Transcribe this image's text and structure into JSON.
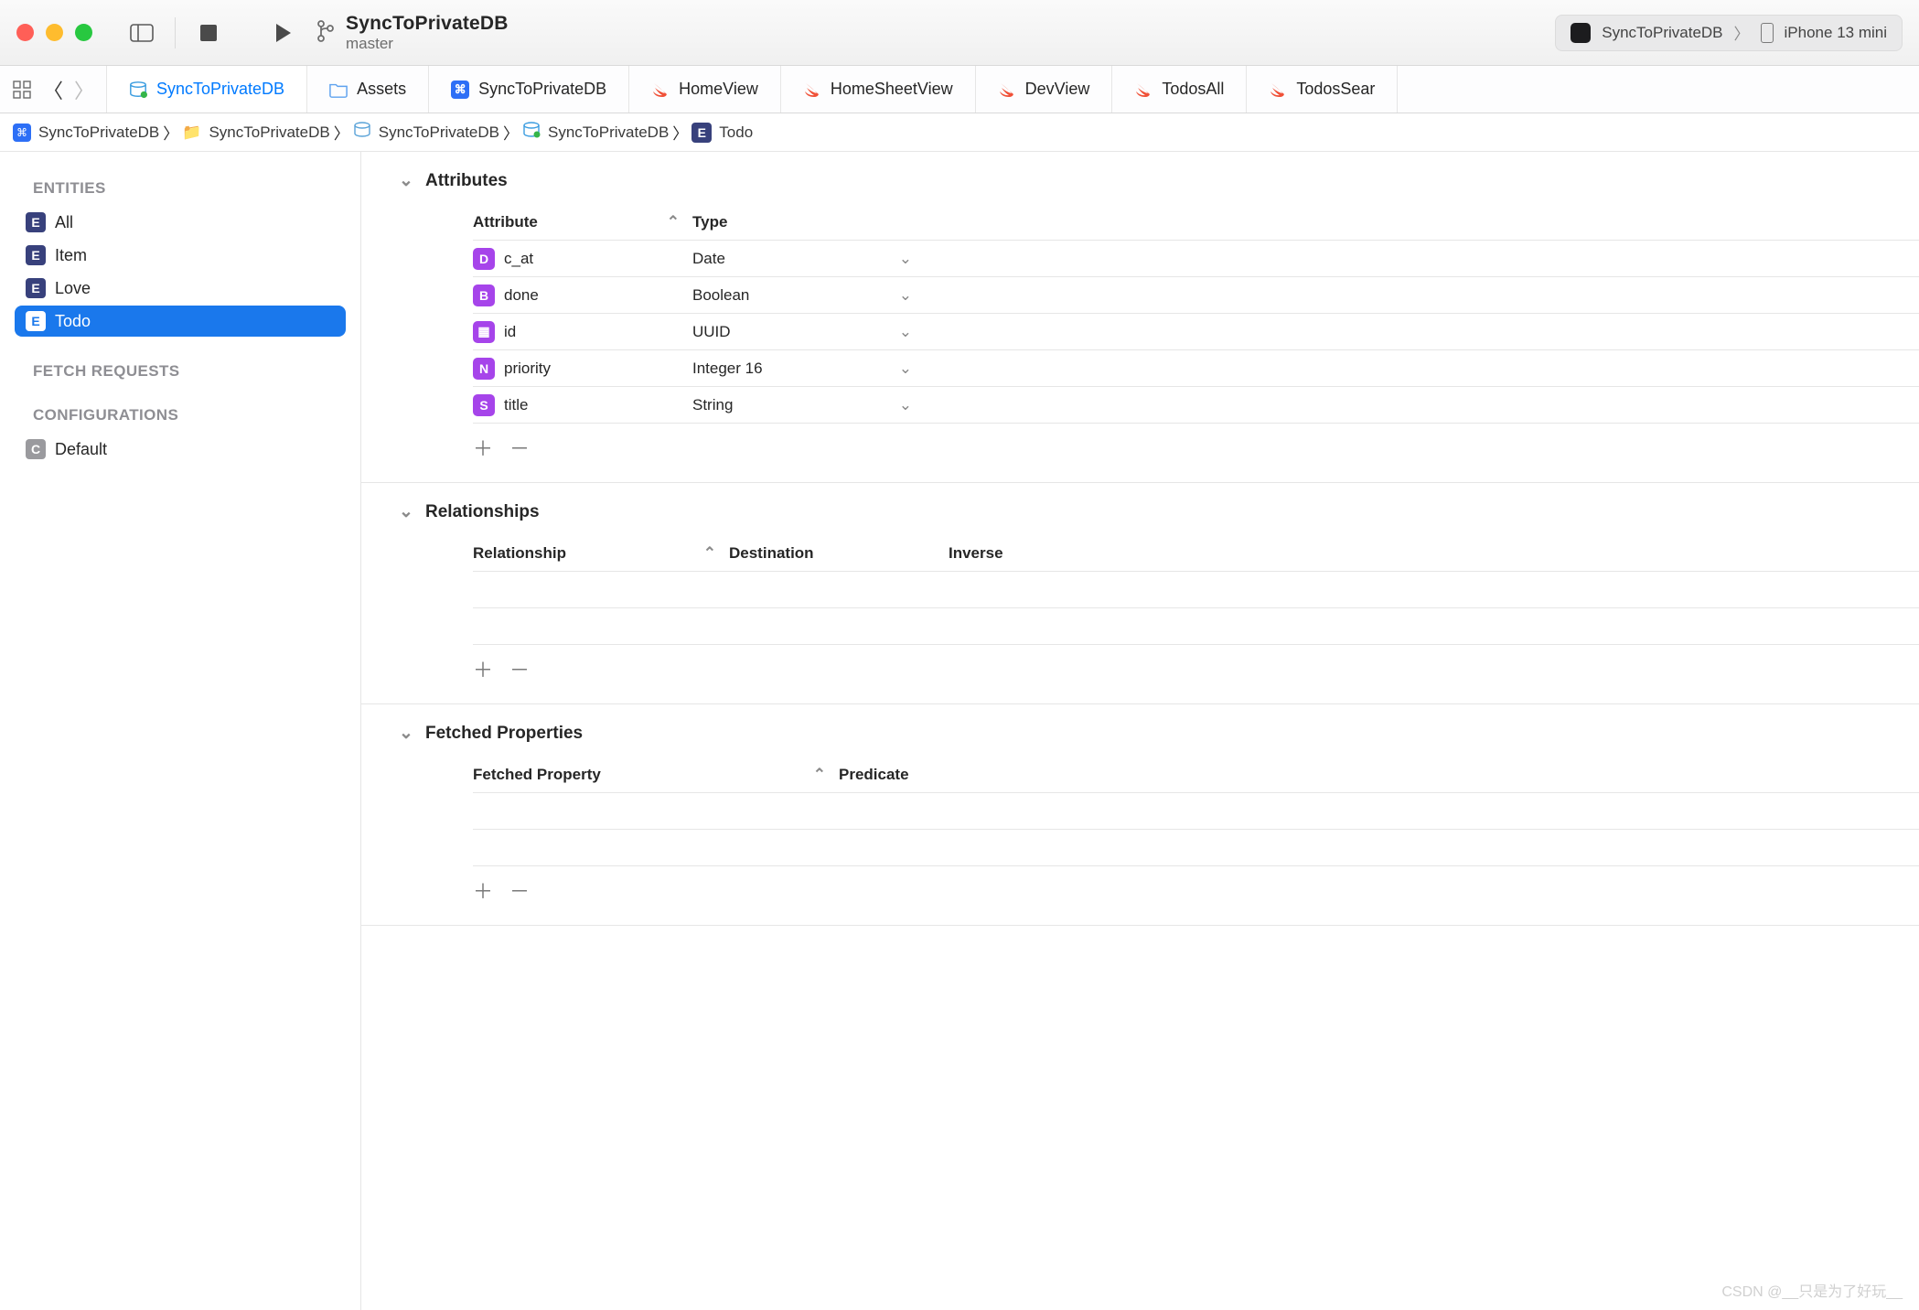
{
  "window": {
    "title": "SyncToPrivateDB",
    "branch": "master",
    "scheme": "SyncToPrivateDB",
    "device": "iPhone 13 mini"
  },
  "tabs": [
    {
      "label": "SyncToPrivateDB",
      "kind": "model",
      "active": true
    },
    {
      "label": "Assets",
      "kind": "folder"
    },
    {
      "label": "SyncToPrivateDB",
      "kind": "app"
    },
    {
      "label": "HomeView",
      "kind": "swift"
    },
    {
      "label": "HomeSheetView",
      "kind": "swift"
    },
    {
      "label": "DevView",
      "kind": "swift"
    },
    {
      "label": "TodosAll",
      "kind": "swift"
    },
    {
      "label": "TodosSear",
      "kind": "swift"
    }
  ],
  "breadcrumb": [
    {
      "label": "SyncToPrivateDB",
      "icon": "app"
    },
    {
      "label": "SyncToPrivateDB",
      "icon": "folder"
    },
    {
      "label": "SyncToPrivateDB",
      "icon": "package"
    },
    {
      "label": "SyncToPrivateDB",
      "icon": "model"
    },
    {
      "label": "Todo",
      "icon": "entity"
    }
  ],
  "sidebar": {
    "sections": {
      "entities_header": "ENTITIES",
      "fetch_header": "FETCH REQUESTS",
      "config_header": "CONFIGURATIONS"
    },
    "entities": [
      {
        "label": "All"
      },
      {
        "label": "Item"
      },
      {
        "label": "Love"
      },
      {
        "label": "Todo",
        "selected": true
      }
    ],
    "configurations": [
      {
        "label": "Default"
      }
    ]
  },
  "editor": {
    "attributes": {
      "title": "Attributes",
      "columns": {
        "c1": "Attribute",
        "c2": "Type"
      },
      "rows": [
        {
          "badge": "D",
          "name": "c_at",
          "type": "Date"
        },
        {
          "badge": "B",
          "name": "done",
          "type": "Boolean"
        },
        {
          "badge": "▦",
          "name": "id",
          "type": "UUID"
        },
        {
          "badge": "N",
          "name": "priority",
          "type": "Integer 16"
        },
        {
          "badge": "S",
          "name": "title",
          "type": "String"
        }
      ]
    },
    "relationships": {
      "title": "Relationships",
      "columns": {
        "c1": "Relationship",
        "c2": "Destination",
        "c3": "Inverse"
      }
    },
    "fetched": {
      "title": "Fetched Properties",
      "columns": {
        "c1": "Fetched Property",
        "c2": "Predicate"
      }
    }
  },
  "watermark": "CSDN @__只是为了好玩__"
}
